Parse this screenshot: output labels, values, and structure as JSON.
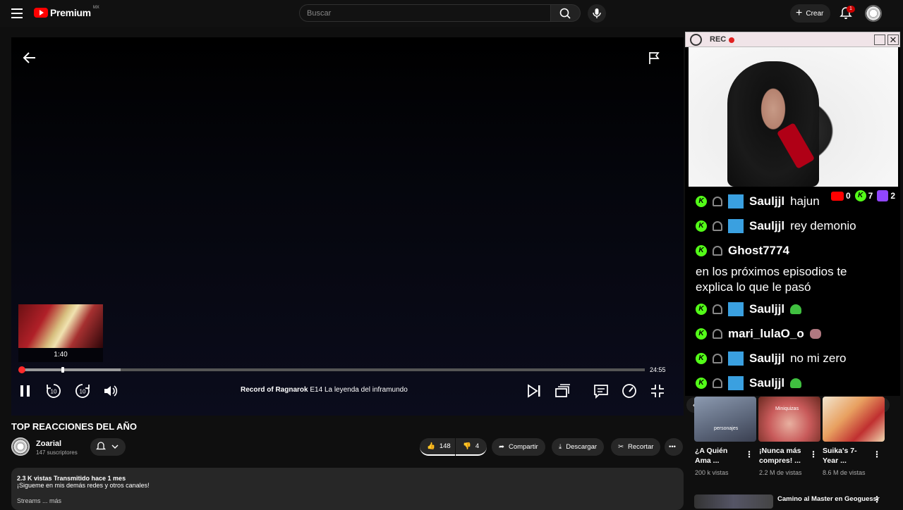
{
  "topbar": {
    "logo_text": "Premium",
    "country": "MX",
    "search_placeholder": "Buscar",
    "create_label": "Crear",
    "notif_count": "1"
  },
  "player": {
    "preview_time": "1:40",
    "duration": "24:55",
    "progress_played_fraction": 0.004,
    "progress_buffered_fraction": 0.16,
    "progress_hover_fraction": 0.065,
    "episode_series": "Record of Ragnarok",
    "episode_code": "E14",
    "episode_name": "La leyenda del inframundo"
  },
  "video": {
    "title": "TOP REACCIONES DEL AÑO",
    "channel": "Zoarial",
    "subscribers": "147 suscriptores",
    "likes": "148",
    "dislikes": "4",
    "share": "Compartir",
    "download": "Descargar",
    "clip": "Recortar",
    "description_meta": "2.3 K vistas  Transmitido hace 1 mes",
    "description_line": "¡Sigueme en mis demás redes y otros canales!",
    "description_more": "Streams ... más"
  },
  "overlay": {
    "rec_label": "REC",
    "counters": {
      "youtube": "0",
      "kick": "7",
      "twitch": "2"
    },
    "messages": [
      {
        "user": "Sauljjl",
        "text": "hajun"
      },
      {
        "user": "Sauljjl",
        "text": "rey demonio"
      },
      {
        "user": "Ghost7774",
        "text": ""
      },
      {
        "user": "",
        "text": "en los próximos episodios te explica lo que le pasó"
      },
      {
        "user": "Sauljjl",
        "text": ""
      },
      {
        "user": "mari_lulaO_o",
        "text": ""
      },
      {
        "user": "Sauljjl",
        "text": "no mi zero"
      },
      {
        "user": "Sauljjl",
        "text": ""
      }
    ]
  },
  "recommendations": [
    {
      "title": "¿A Quién Ama ...",
      "views": "200 k vistas",
      "thumb_label": "personajes"
    },
    {
      "title": "¡Nunca más compres! ...",
      "views": "2.2 M de vistas",
      "thumb_label": "Miniquizas"
    },
    {
      "title": "Suika's 7-Year ...",
      "views": "8.6 M de vistas",
      "thumb_label": ""
    }
  ],
  "next_title": "Camino al Master en Geoguessr"
}
